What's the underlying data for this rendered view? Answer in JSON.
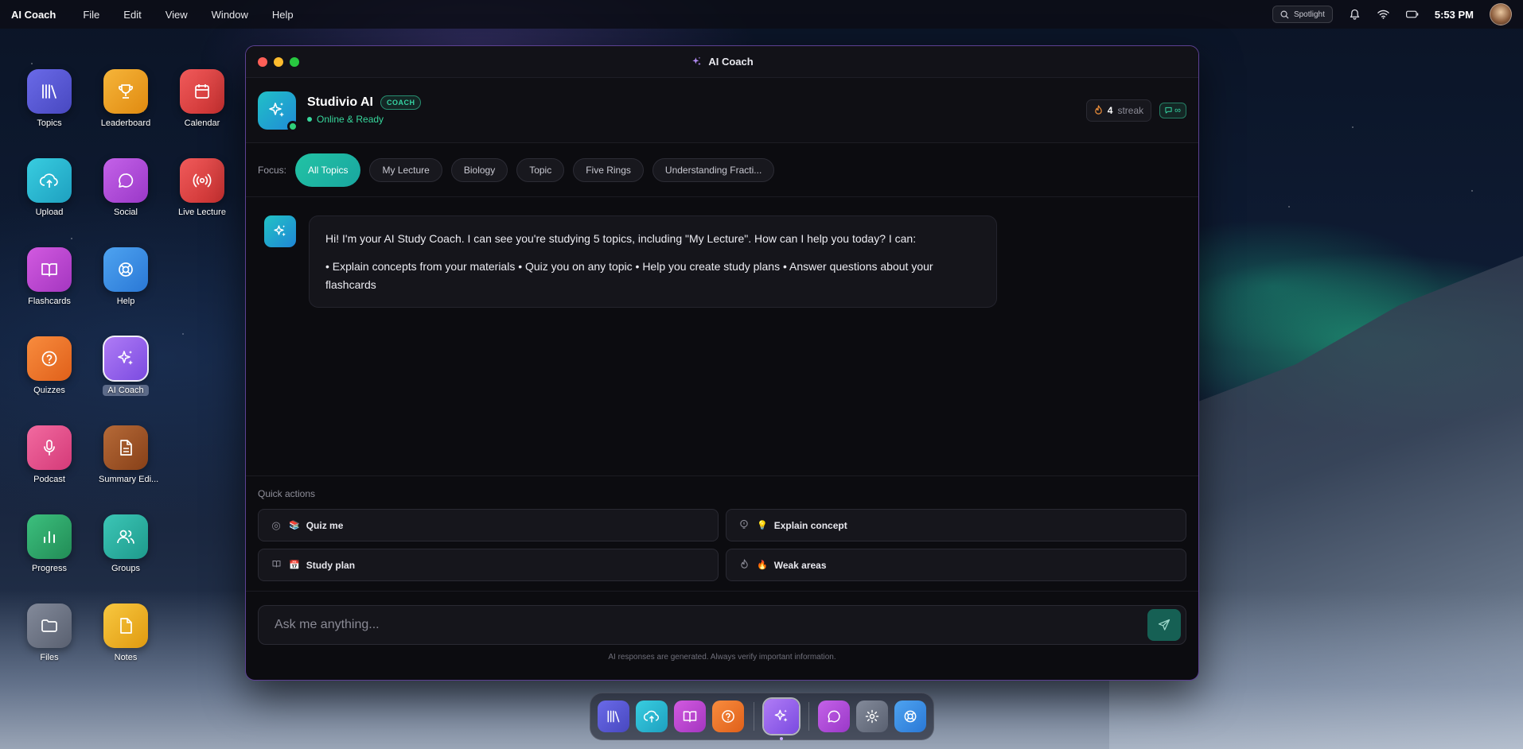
{
  "menubar": {
    "app_name": "AI Coach",
    "menus": [
      "File",
      "Edit",
      "View",
      "Window",
      "Help"
    ],
    "spotlight_label": "Spotlight",
    "time": "5:53 PM"
  },
  "desktop": {
    "icons": [
      {
        "label": "Topics",
        "icon": "library-icon",
        "color": "#5b5bd6"
      },
      {
        "label": "Leaderboard",
        "icon": "trophy-icon",
        "color": "#f0a020"
      },
      {
        "label": "Calendar",
        "icon": "calendar-icon",
        "color": "#e04848"
      },
      {
        "label": "Upload",
        "icon": "cloud-upload-icon",
        "color": "#25b8d0"
      },
      {
        "label": "Social",
        "icon": "chat-bubble-icon",
        "color": "#b24fd6"
      },
      {
        "label": "Live Lecture",
        "icon": "broadcast-icon",
        "color": "#e04848"
      },
      {
        "label": "Flashcards",
        "icon": "book-icon",
        "color": "#c04ad0"
      },
      {
        "label": "Help",
        "icon": "lifebuoy-icon",
        "color": "#3b8fe8"
      },
      {
        "label": "Quizzes",
        "icon": "question-icon",
        "color": "#f07a2a"
      },
      {
        "label": "AI Coach",
        "icon": "sparkles-icon",
        "color": "#9a6af0"
      },
      {
        "label": "Podcast",
        "icon": "microphone-icon",
        "color": "#e8508a"
      },
      {
        "label": "Summary Edi...",
        "icon": "document-icon",
        "color": "#a0562a"
      },
      {
        "label": "Progress",
        "icon": "bar-chart-icon",
        "color": "#2faa6a"
      },
      {
        "label": "Groups",
        "icon": "users-icon",
        "color": "#2fb0a0"
      },
      {
        "label": "Files",
        "icon": "folder-icon",
        "color": "#6c7384"
      },
      {
        "label": "Notes",
        "icon": "note-icon",
        "color": "#f0b020"
      }
    ]
  },
  "window": {
    "title": "AI Coach",
    "coach": {
      "name": "Studivio AI",
      "badge": "COACH",
      "status": "Online & Ready"
    },
    "streak": {
      "count": "4",
      "label": "streak"
    },
    "chat_badge": "∞",
    "focus": {
      "label": "Focus:",
      "chips": [
        "All Topics",
        "My Lecture",
        "Biology",
        "Topic",
        "Five Rings",
        "Understanding Fracti..."
      ],
      "active": "All Topics"
    },
    "messages": [
      {
        "sender": "ai",
        "line1": "Hi! I'm your AI Study Coach. I can see you're studying 5 topics, including \"My Lecture\". How can I help you today? I can:",
        "line2": "• Explain concepts from your materials • Quiz you on any topic • Help you create study plans • Answer questions about your flashcards"
      }
    ],
    "quick_actions": {
      "title": "Quick actions",
      "items": [
        {
          "label": "Quiz me",
          "emoji": "📚",
          "icon": "target-icon"
        },
        {
          "label": "Explain concept",
          "emoji": "💡",
          "icon": "lightbulb-icon"
        },
        {
          "label": "Study plan",
          "emoji": "📅",
          "icon": "book-icon"
        },
        {
          "label": "Weak areas",
          "emoji": "🔥",
          "icon": "flame-icon"
        }
      ]
    },
    "composer": {
      "placeholder": "Ask me anything...",
      "disclaimer": "AI responses are generated. Always verify important information."
    }
  },
  "dock": {
    "items": [
      {
        "name": "topics",
        "icon": "library-icon",
        "color": "#5b5bd6"
      },
      {
        "name": "upload",
        "icon": "cloud-upload-icon",
        "color": "#25b8d0"
      },
      {
        "name": "flashcards",
        "icon": "book-icon",
        "color": "#c04ad0"
      },
      {
        "name": "quizzes",
        "icon": "question-icon",
        "color": "#f07a2a"
      },
      {
        "name": "ai-coach",
        "icon": "sparkles-icon",
        "color": "#9a6af0",
        "active": true
      },
      {
        "name": "social",
        "icon": "chat-bubble-icon",
        "color": "#b24fd6"
      },
      {
        "name": "settings",
        "icon": "gear-icon",
        "color": "#6c7384"
      },
      {
        "name": "help",
        "icon": "lifebuoy-icon",
        "color": "#3b8fe8"
      }
    ]
  }
}
